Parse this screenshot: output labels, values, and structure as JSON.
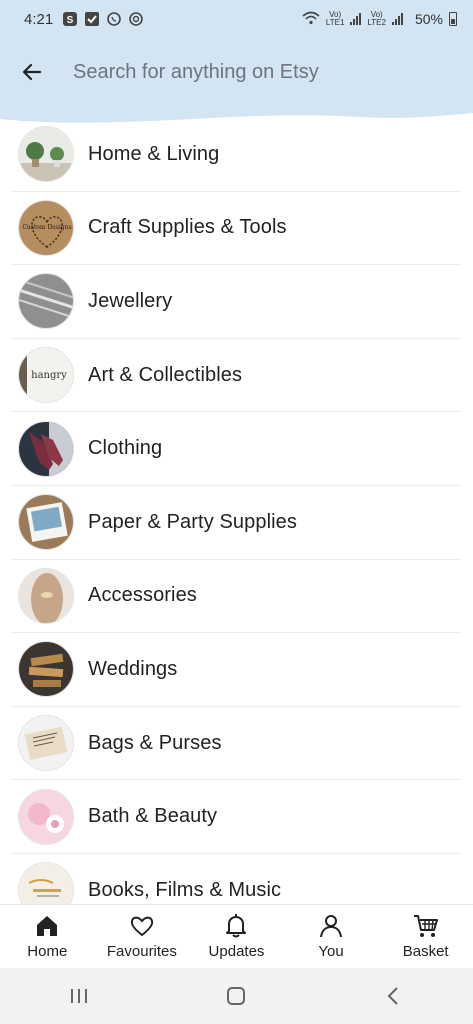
{
  "status_bar": {
    "time": "4:21",
    "lte1_top": "Vo)",
    "lte1_bottom": "LTE1",
    "lte2_top": "Vo)",
    "lte2_bottom": "LTE2",
    "battery": "50%"
  },
  "search": {
    "placeholder": "Search for anything on Etsy"
  },
  "categories": [
    {
      "label": "Home & Living"
    },
    {
      "label": "Craft Supplies & Tools",
      "thumb_text": "Custom Designs"
    },
    {
      "label": "Jewellery"
    },
    {
      "label": "Art & Collectibles",
      "thumb_text": "hangry"
    },
    {
      "label": "Clothing"
    },
    {
      "label": "Paper & Party Supplies"
    },
    {
      "label": "Accessories"
    },
    {
      "label": "Weddings"
    },
    {
      "label": "Bags & Purses"
    },
    {
      "label": "Bath & Beauty"
    },
    {
      "label": "Books, Films & Music"
    }
  ],
  "bottom_nav": {
    "home": "Home",
    "favourites": "Favourites",
    "updates": "Updates",
    "you": "You",
    "basket": "Basket"
  },
  "colors": {
    "header_bg": "#d3e4f3",
    "text": "#222222",
    "divider": "#ececec"
  }
}
